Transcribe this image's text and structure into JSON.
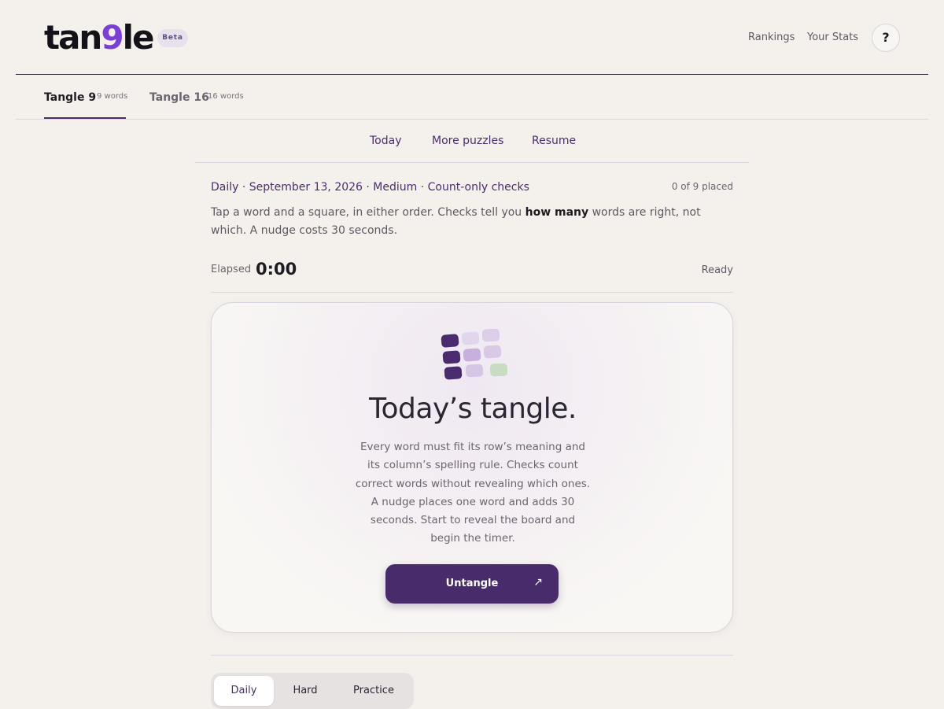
{
  "header": {
    "logo_text_a": "tan",
    "logo_text_nine": "9",
    "logo_text_b": "le",
    "beta_badge": "Beta",
    "nav": [
      {
        "label": "Rankings"
      },
      {
        "label": "Your Stats"
      }
    ],
    "help_label": "?"
  },
  "mode_tabs": [
    {
      "name": "Tangle 9",
      "count": "9 words",
      "active": true
    },
    {
      "name": "Tangle 16",
      "count": "16 words",
      "active": false
    }
  ],
  "subnav": [
    {
      "label": "Today"
    },
    {
      "label": "More puzzles"
    },
    {
      "label": "Resume"
    }
  ],
  "puzzle": {
    "meta": "Daily · September 13, 2026 · Medium · Count-only checks",
    "placed": "0 of 9 placed",
    "instructions_pre": "Tap a word and a square, in either order. Checks tell you ",
    "instructions_bold": "how many",
    "instructions_post": " words are right, not which. A nudge costs 30 seconds."
  },
  "timer": {
    "label": "Elapsed",
    "value": "0:00",
    "status": "Ready"
  },
  "card": {
    "title": "Today’s tangle.",
    "body": "Every word must fit its row’s meaning and its column’s spelling rule. Checks count correct words without revealing which ones. A nudge places one word and adds 30 seconds. Start to reveal the board and begin the timer.",
    "button_label": "Untangle",
    "button_icon": "arrow-up-right-icon",
    "tile_colors": [
      "#4a2c6e",
      "#e2d6ec",
      "#dccde8",
      "#4a2c6e",
      "#c7b0dd",
      "#d9c9e6",
      "#4a2c6e",
      "#d6c6e5",
      "#c8dcc2"
    ]
  },
  "difficulty": {
    "options": [
      {
        "label": "Daily",
        "active": true
      },
      {
        "label": "Hard",
        "active": false
      },
      {
        "label": "Practice",
        "active": false
      }
    ]
  },
  "colors": {
    "accent": "#472b6b",
    "logo_nine": "#7b3fd6",
    "background": "#f4f1ec"
  }
}
